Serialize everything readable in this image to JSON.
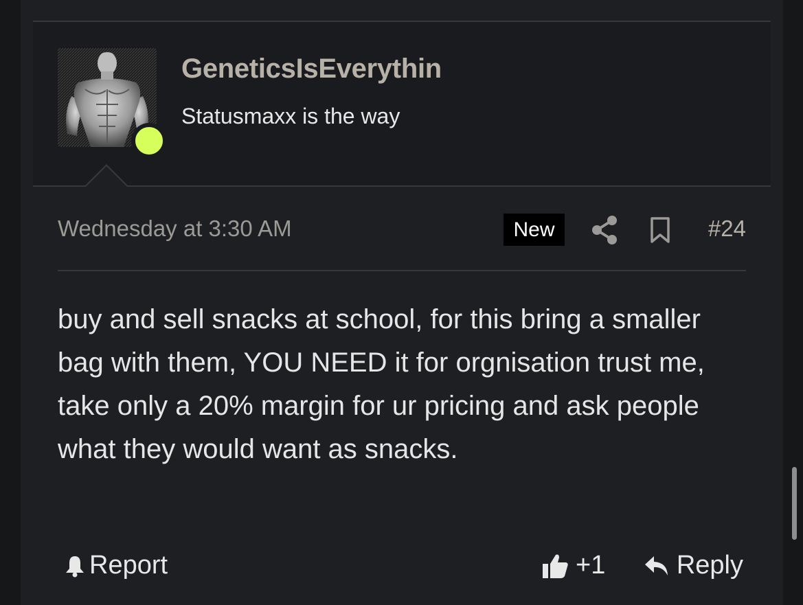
{
  "user": {
    "username": "GeneticsIsEverythin",
    "title": "Statusmaxx is the way",
    "online": true,
    "online_color": "#d6ff5c"
  },
  "post": {
    "date": "Wednesday at 3:30 AM",
    "badge": "New",
    "number": "#24",
    "message": "buy and sell snacks at school, for this bring a smaller bag with them, YOU NEED it for orgnisation trust me, take only a 20% margin for ur pricing and ask people what they would want as snacks.",
    "actions": {
      "share_icon": "share-icon",
      "bookmark_icon": "bookmark-icon"
    }
  },
  "footer": {
    "report_label": "Report",
    "like_count": "+1",
    "reply_label": "Reply"
  }
}
